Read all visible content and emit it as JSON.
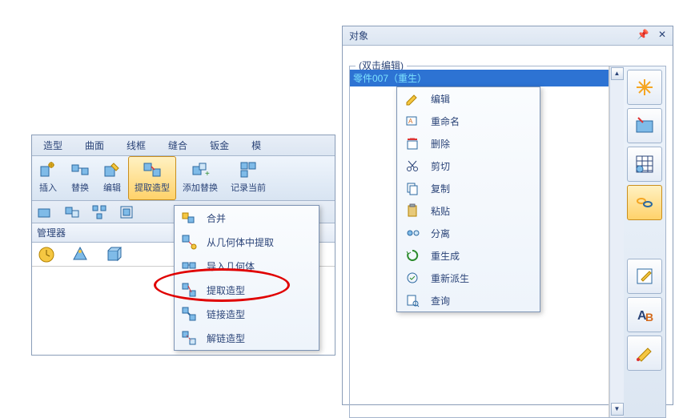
{
  "ribbon": {
    "tabs": [
      "造型",
      "曲面",
      "线框",
      "缝合",
      "钣金",
      "模"
    ],
    "buttons": [
      {
        "label": "插入"
      },
      {
        "label": "替换"
      },
      {
        "label": "编辑"
      },
      {
        "label": "提取造型"
      },
      {
        "label": "添加替换"
      },
      {
        "label": "记录当前"
      }
    ]
  },
  "manager": {
    "title": "管理器"
  },
  "dropdown": {
    "items": [
      {
        "label": "合并"
      },
      {
        "label": "从几何体中提取"
      },
      {
        "label": "导入几何体"
      },
      {
        "label": "提取造型"
      },
      {
        "label": "链接造型"
      },
      {
        "label": "解链造型"
      }
    ]
  },
  "right_panel": {
    "title": "对象",
    "fieldset": "(双击编辑)",
    "tree_item": "零件007（重生）"
  },
  "context_menu": {
    "items": [
      {
        "label": "编辑"
      },
      {
        "label": "重命名"
      },
      {
        "label": "删除"
      },
      {
        "label": "剪切"
      },
      {
        "label": "复制"
      },
      {
        "label": "粘贴"
      },
      {
        "label": "分离"
      },
      {
        "label": "重生成"
      },
      {
        "label": "重新派生"
      },
      {
        "label": "查询"
      }
    ]
  }
}
